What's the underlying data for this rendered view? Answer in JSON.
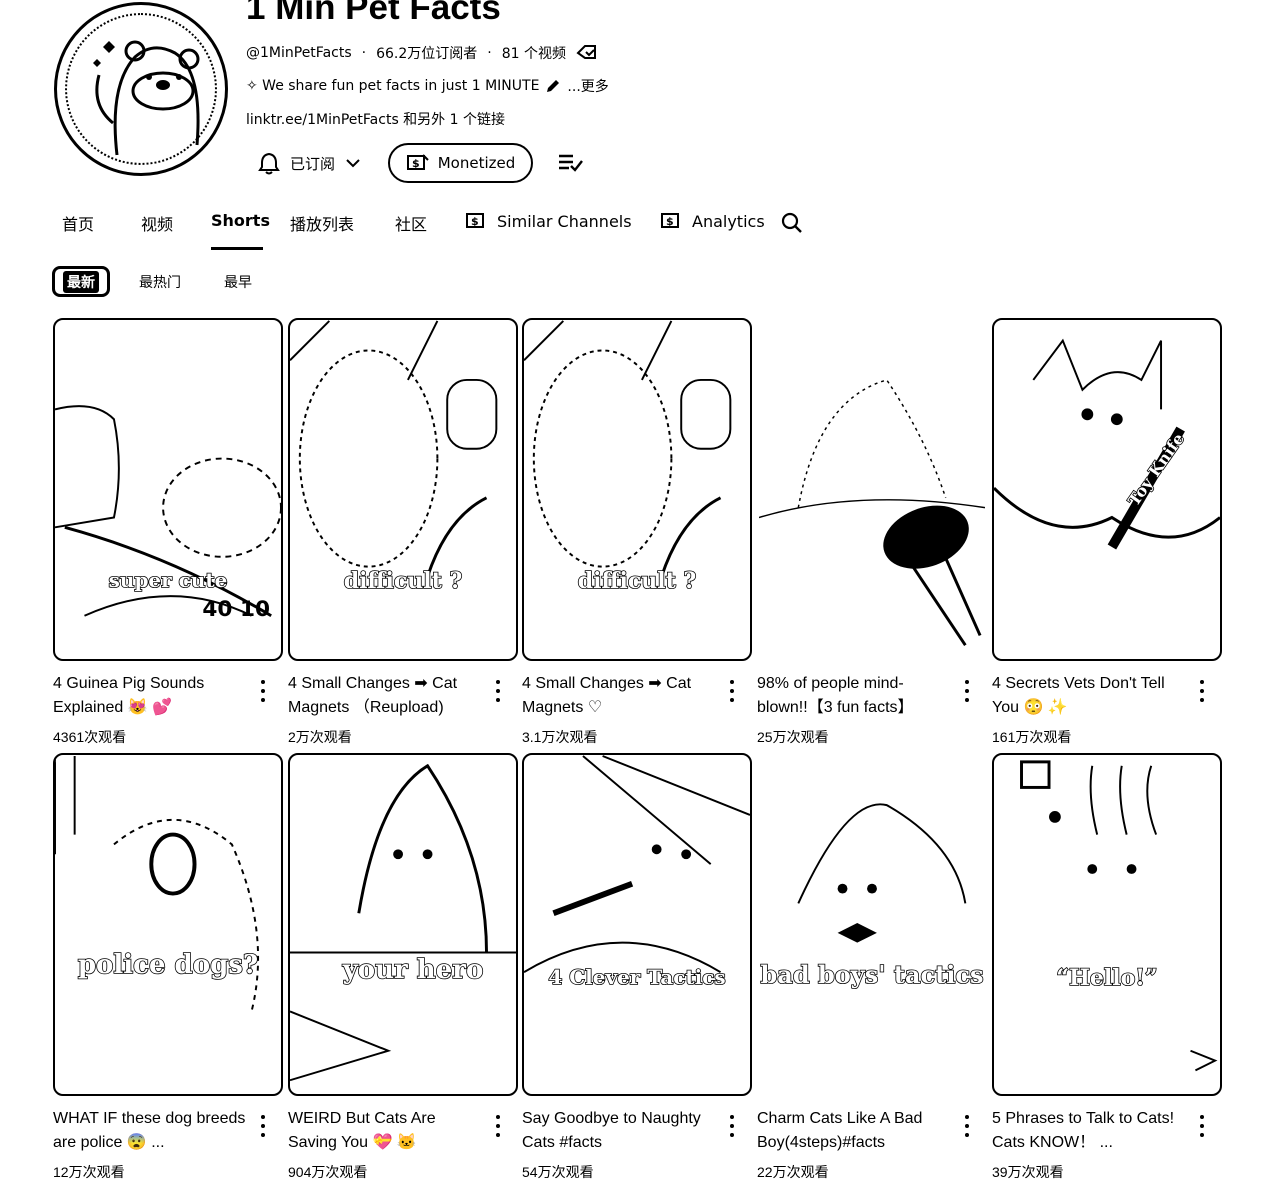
{
  "channel": {
    "title": "1 Min Pet Facts",
    "handle": "@1MinPetFacts",
    "subscribers": "66.2万位订阅者",
    "video_count": "81 个视频",
    "description": "✧ We share fun pet facts in just 1 MINUTE",
    "more_label": "...更多",
    "link_text": "linktr.ee/1MinPetFacts 和另外 1 个链接",
    "subscribed_label": "已订阅",
    "monetized_label": "Monetized"
  },
  "tabs": [
    {
      "label": "首页"
    },
    {
      "label": "视频"
    },
    {
      "label": "Shorts"
    },
    {
      "label": "播放列表"
    },
    {
      "label": "社区"
    },
    {
      "label": "Similar Channels"
    },
    {
      "label": "Analytics"
    }
  ],
  "active_tab": "Shorts",
  "chips": [
    {
      "label": "最新"
    },
    {
      "label": "最热门"
    },
    {
      "label": "最早"
    }
  ],
  "videos": [
    {
      "title": "4 Guinea Pig Sounds Explained 😻 💕",
      "views": "4361次观看",
      "overlay": "super cute"
    },
    {
      "title": "4 Small Changes ➡ Cat Magnets （Reupload)",
      "views": "2万次观看",
      "overlay": "difficult ?"
    },
    {
      "title": "4 Small Changes ➡ Cat Magnets ♡",
      "views": "3.1万次观看",
      "overlay": "difficult ?"
    },
    {
      "title": "98% of people mind-blown!!【3 fun facts】",
      "views": "25万次观看",
      "overlay": ""
    },
    {
      "title": "4 Secrets Vets Don't Tell You 😳 ✨",
      "views": "161万次观看",
      "overlay": "Toy Knife"
    },
    {
      "title": "WHAT IF these dog breeds are police 😨 ...",
      "views": "12万次观看",
      "overlay": "police dogs?"
    },
    {
      "title": "WEIRD But Cats Are Saving You 💝 🐱",
      "views": "904万次观看",
      "overlay": "your hero"
    },
    {
      "title": "Say Goodbye to Naughty Cats #facts",
      "views": "54万次观看",
      "overlay": "4 Clever Tactics"
    },
    {
      "title": "Charm Cats Like A Bad Boy(4steps)#facts",
      "views": "22万次观看",
      "overlay": "bad boys' tactics"
    },
    {
      "title": "5 Phrases to Talk to Cats! Cats KNOW！ ...",
      "views": "39万次观看",
      "overlay": "“Hello!”"
    }
  ],
  "icons": {
    "verified": "tag-check-icon",
    "bell": "bell-icon",
    "chevron": "chevron-down-icon",
    "monetized": "dollar-icon",
    "sort": "sort-lines-icon",
    "search": "search-icon",
    "menu": "more-vert-icon"
  }
}
